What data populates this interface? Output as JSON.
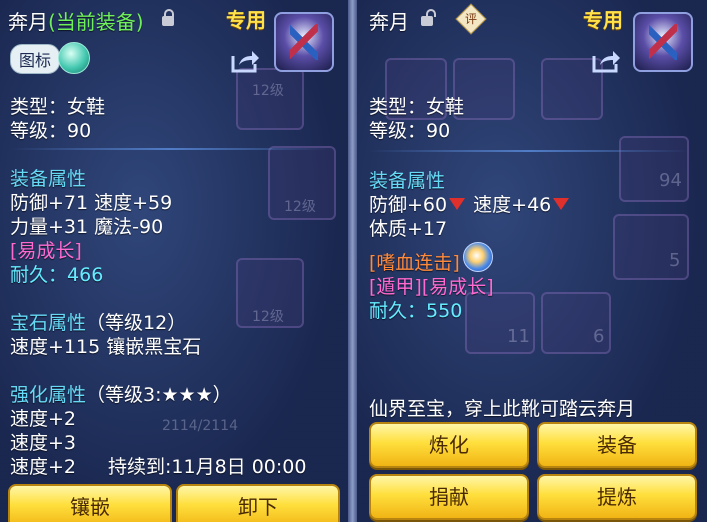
{
  "left": {
    "name": "奔月",
    "current_tag": "(当前装备)",
    "special_label": "专用",
    "badge_label": "图标",
    "type_line": "类型：女鞋",
    "level_line": "等级：90",
    "equip_header": "装备属性",
    "stat_line1": "防御+71 速度+59",
    "stat_line2": "力量+31 魔法-90",
    "growth_tag": "[易成长]",
    "durability_label": "耐久：",
    "durability_value": "466",
    "gem_header": "宝石属性",
    "gem_level": "（等级12）",
    "gem_line": "速度+115 镶嵌黑宝石",
    "enhance_header": "强化属性",
    "enhance_level": "（等级3:★★★）",
    "enhance_lines": [
      "速度+2",
      "速度+3",
      "速度+2"
    ],
    "enhance_duration": "持续到:11月8日 00:00",
    "btn_inlay": "镶嵌",
    "btn_unequip": "卸下"
  },
  "right": {
    "name": "奔月",
    "review_label": "评",
    "special_label": "专用",
    "type_line": "类型：女鞋",
    "level_line": "等级：90",
    "equip_header": "装备属性",
    "defense": "防御+60",
    "speed": "速度+46",
    "constitution": "体质+17",
    "skill_tag": "[嗜血连击]",
    "tag_line": "[遁甲][易成长]",
    "durability_label": "耐久：",
    "durability_value": "550",
    "flavor_text": "仙界至宝，穿上此靴可踏云奔月",
    "btn_refine": "炼化",
    "btn_equip": "装备",
    "btn_donate": "捐献",
    "btn_extract": "提炼"
  },
  "background_hints": {
    "bg_level1": "12级",
    "bg_level2": "12级",
    "bg_level3": "12级",
    "bg_hp": "2114/2114",
    "bg_count1": "94",
    "bg_count2": "11",
    "bg_count3": "6",
    "bg_count4": "5"
  },
  "colors": {
    "panel_bg": "#223464",
    "section": "#66d9f4",
    "pink": "#ff6ad0",
    "cyan": "#66ecff",
    "gold": "#ffe14a",
    "green": "#6ff05a"
  }
}
